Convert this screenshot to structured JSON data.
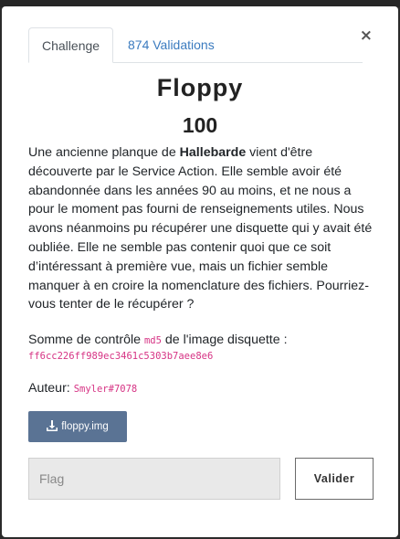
{
  "modal": {
    "close_glyph": "×",
    "tabs": [
      {
        "label": "Challenge",
        "active": true
      },
      {
        "label": "874 Validations",
        "active": false
      }
    ],
    "title": "Floppy",
    "value": "100",
    "description": {
      "p1_pre": "Une ancienne planque de ",
      "p1_bold": "Hallebarde",
      "p1_post": " vient d'être découverte par le Service Action. Elle semble avoir été abandonnée dans les années 90 au moins, et ne nous a pour le moment pas fourni de renseignements utiles. Nous avons néanmoins pu récupérer une disquette qui y avait été oubliée. Elle ne semble pas contenir quoi que ce soit d’intéressant à première vue, mais un fichier semble manquer à en croire la nomenclature des fichiers. Pourriez-vous tenter de le récupérer ?"
    },
    "checksum": {
      "pre": "Somme de contrôle ",
      "algo": "md5",
      "post": " de l'image disquette :",
      "hash": "ff6cc226ff989ec3461c5303b7aee8e6"
    },
    "author": {
      "label": "Auteur: ",
      "name": "Smyler#7078"
    },
    "download": {
      "label": "floppy.img",
      "icon": "download-icon"
    },
    "flag_input": {
      "placeholder": "Flag",
      "value": ""
    },
    "submit_label": "Valider"
  },
  "colors": {
    "tab_link": "#3b7bbf",
    "code": "#d63384",
    "download_button": "#5a7394"
  }
}
